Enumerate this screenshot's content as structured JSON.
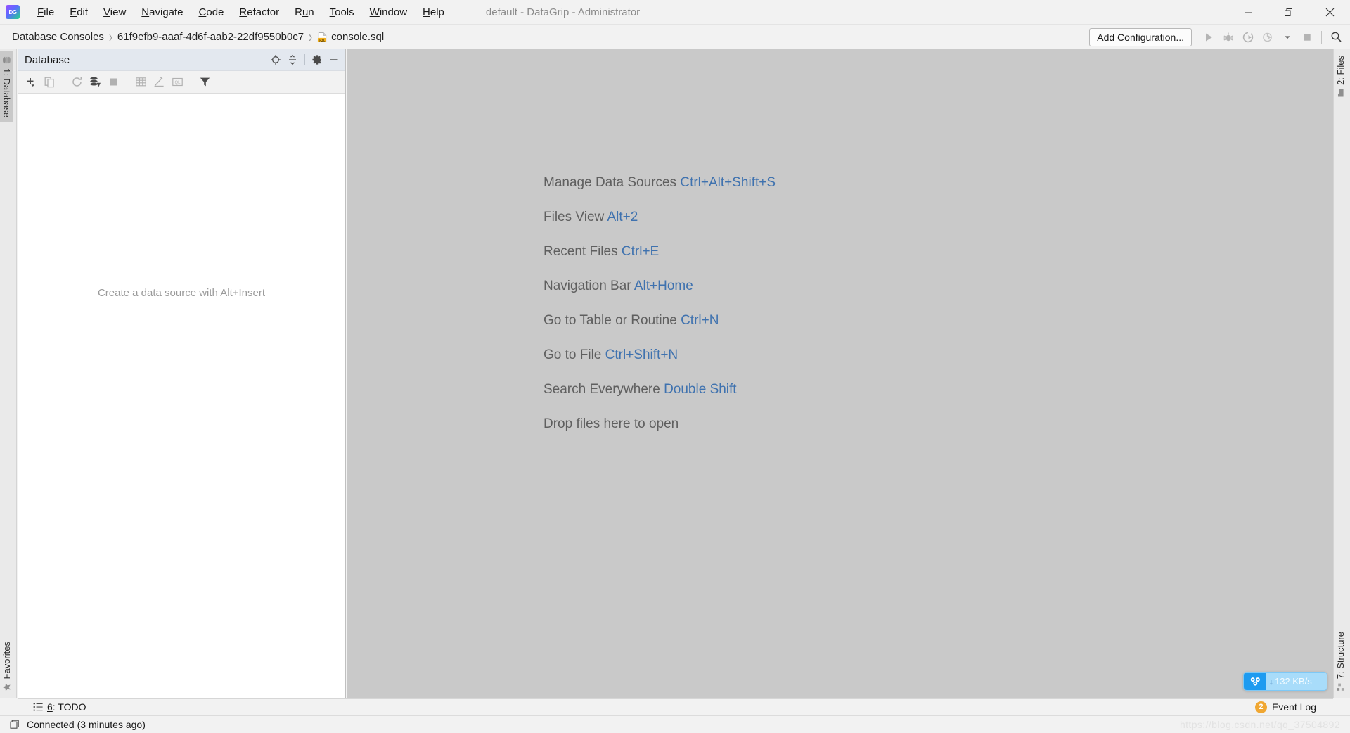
{
  "titlebar": {
    "logo_text": "DG",
    "logo_name": "datagrip-logo",
    "window_title": "default - DataGrip - Administrator",
    "menus": [
      {
        "label": "File",
        "mnemonic": "F"
      },
      {
        "label": "Edit",
        "mnemonic": "E"
      },
      {
        "label": "View",
        "mnemonic": "V"
      },
      {
        "label": "Navigate",
        "mnemonic": "N"
      },
      {
        "label": "Code",
        "mnemonic": "C"
      },
      {
        "label": "Refactor",
        "mnemonic": "R"
      },
      {
        "label": "Run",
        "mnemonic": "u"
      },
      {
        "label": "Tools",
        "mnemonic": "T"
      },
      {
        "label": "Window",
        "mnemonic": "W"
      },
      {
        "label": "Help",
        "mnemonic": "H"
      }
    ],
    "window_controls": [
      {
        "name": "minimize-button",
        "icon": "minimize-icon"
      },
      {
        "name": "restore-button",
        "icon": "restore-icon"
      },
      {
        "name": "close-button",
        "icon": "close-icon"
      }
    ]
  },
  "navbar": {
    "breadcrumbs": [
      {
        "label": "Database Consoles",
        "icon": null
      },
      {
        "label": "61f9efb9-aaaf-4d6f-aab2-22df9550b0c7",
        "icon": null
      },
      {
        "label": "console.sql",
        "icon": "sql-file-icon"
      }
    ],
    "separator": "›",
    "add_configuration_label": "Add Configuration...",
    "toolbar_buttons": [
      {
        "name": "run-button",
        "icon": "play-icon",
        "enabled": false
      },
      {
        "name": "debug-button",
        "icon": "bug-icon",
        "enabled": false
      },
      {
        "name": "run-with-coverage-button",
        "icon": "coverage-icon",
        "enabled": false
      },
      {
        "name": "profile-button",
        "icon": "profile-icon",
        "enabled": false
      },
      {
        "name": "profile-dropdown",
        "icon": "chevron-down-icon",
        "enabled": false
      },
      {
        "name": "stop-button",
        "icon": "stop-icon",
        "enabled": false
      },
      {
        "name": "search-everywhere-button",
        "icon": "search-icon",
        "enabled": true
      }
    ]
  },
  "left_stripe": {
    "top_tab": {
      "label": "1: Database",
      "icon": "database-icon",
      "active": true
    },
    "bottom_tab": {
      "label": "Favorites",
      "icon": "star-icon",
      "active": false
    }
  },
  "right_stripe": {
    "top_tab": {
      "label": "2: Files",
      "icon": "folder-icon",
      "active": false
    },
    "bottom_tab": {
      "label": "7: Structure",
      "icon": "structure-icon",
      "active": false
    }
  },
  "database_panel": {
    "title": "Database",
    "header_buttons": [
      {
        "name": "scroll-from-source-button",
        "icon": "crosshair-icon"
      },
      {
        "name": "collapse-all-button",
        "icon": "collapse-all-icon"
      },
      {
        "name": "settings-button",
        "icon": "gear-icon"
      },
      {
        "name": "hide-button",
        "icon": "minus-icon"
      }
    ],
    "toolbar_buttons": [
      {
        "name": "add-data-source-button",
        "icon": "plus-dropdown-icon",
        "enabled": true
      },
      {
        "name": "duplicate-button",
        "icon": "copy-icon",
        "enabled": false
      },
      {
        "name": "refresh-button",
        "icon": "refresh-icon",
        "enabled": false
      },
      {
        "name": "sync-button",
        "icon": "sync-db-icon",
        "enabled": true
      },
      {
        "name": "stop-refresh-button",
        "icon": "stop-square-icon",
        "enabled": false
      },
      {
        "name": "open-table-editor-button",
        "icon": "table-icon",
        "enabled": false
      },
      {
        "name": "modify-button",
        "icon": "pencil-icon",
        "enabled": false
      },
      {
        "name": "jump-to-query-console-button",
        "icon": "ql-icon",
        "enabled": false
      },
      {
        "name": "filter-button",
        "icon": "funnel-icon",
        "enabled": true
      }
    ],
    "empty_message": "Create a data source with Alt+Insert"
  },
  "editor": {
    "hints": [
      {
        "action": "Manage Data Sources",
        "shortcut": "Ctrl+Alt+Shift+S"
      },
      {
        "action": "Files View",
        "shortcut": "Alt+2"
      },
      {
        "action": "Recent Files",
        "shortcut": "Ctrl+E"
      },
      {
        "action": "Navigation Bar",
        "shortcut": "Alt+Home"
      },
      {
        "action": "Go to Table or Routine",
        "shortcut": "Ctrl+N"
      },
      {
        "action": "Go to File",
        "shortcut": "Ctrl+Shift+N"
      },
      {
        "action": "Search Everywhere",
        "shortcut": "Double Shift"
      },
      {
        "action": "Drop files here to open",
        "shortcut": ""
      }
    ]
  },
  "bottom_bar": {
    "todo": {
      "number": "6",
      "label": ": TODO",
      "icon": "todo-list-icon"
    },
    "event_log": {
      "label": "Event Log",
      "badge": "2"
    }
  },
  "statusbar": {
    "connection_status": "Connected (3 minutes ago)",
    "status_icon": "window-icon",
    "watermark": "https://blog.csdn.net/qq_37504892"
  },
  "netdisk_widget": {
    "logo_name": "baidu-netdisk-icon",
    "arrow": "↓",
    "speed": "132 KB/s"
  },
  "colors": {
    "titlebar_bg": "#f2f2f2",
    "editor_bg": "#c9c9c9",
    "panel_header_bg": "#e3e8ef",
    "hint_text": "#5f5f5f",
    "hint_key": "#3f72af",
    "badge_orange": "#f0a732",
    "netdisk_blue": "#1e9bf0",
    "close_hover": "#e81123"
  }
}
